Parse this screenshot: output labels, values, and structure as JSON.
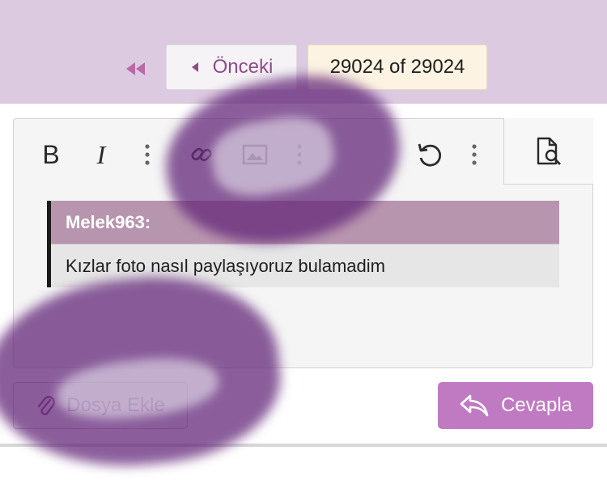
{
  "pager": {
    "first_icon": "double-chevron-left-icon",
    "prev_icon": "caret-left-icon",
    "prev_label": "Önceki",
    "counter": "29024 of 29024"
  },
  "toolbar": {
    "bold_label": "B",
    "italic_label": "I",
    "icons": [
      "bold-icon",
      "italic-icon",
      "more-vertical-icon",
      "link-icon",
      "image-icon",
      "more-vertical-icon",
      "undo-icon",
      "more-vertical-icon",
      "preview-search-icon"
    ]
  },
  "quote": {
    "author": "Melek963:",
    "text": "Kızlar foto nasıl paylaşıyoruz bulamadim"
  },
  "actions": {
    "attach_label": "Dosya Ekle",
    "reply_label": "Cevapla"
  },
  "colors": {
    "top_band": "#dccbe0",
    "accent": "#8d4a8a",
    "reply_button": "#c07ac2",
    "quote_header": "#b895af"
  }
}
